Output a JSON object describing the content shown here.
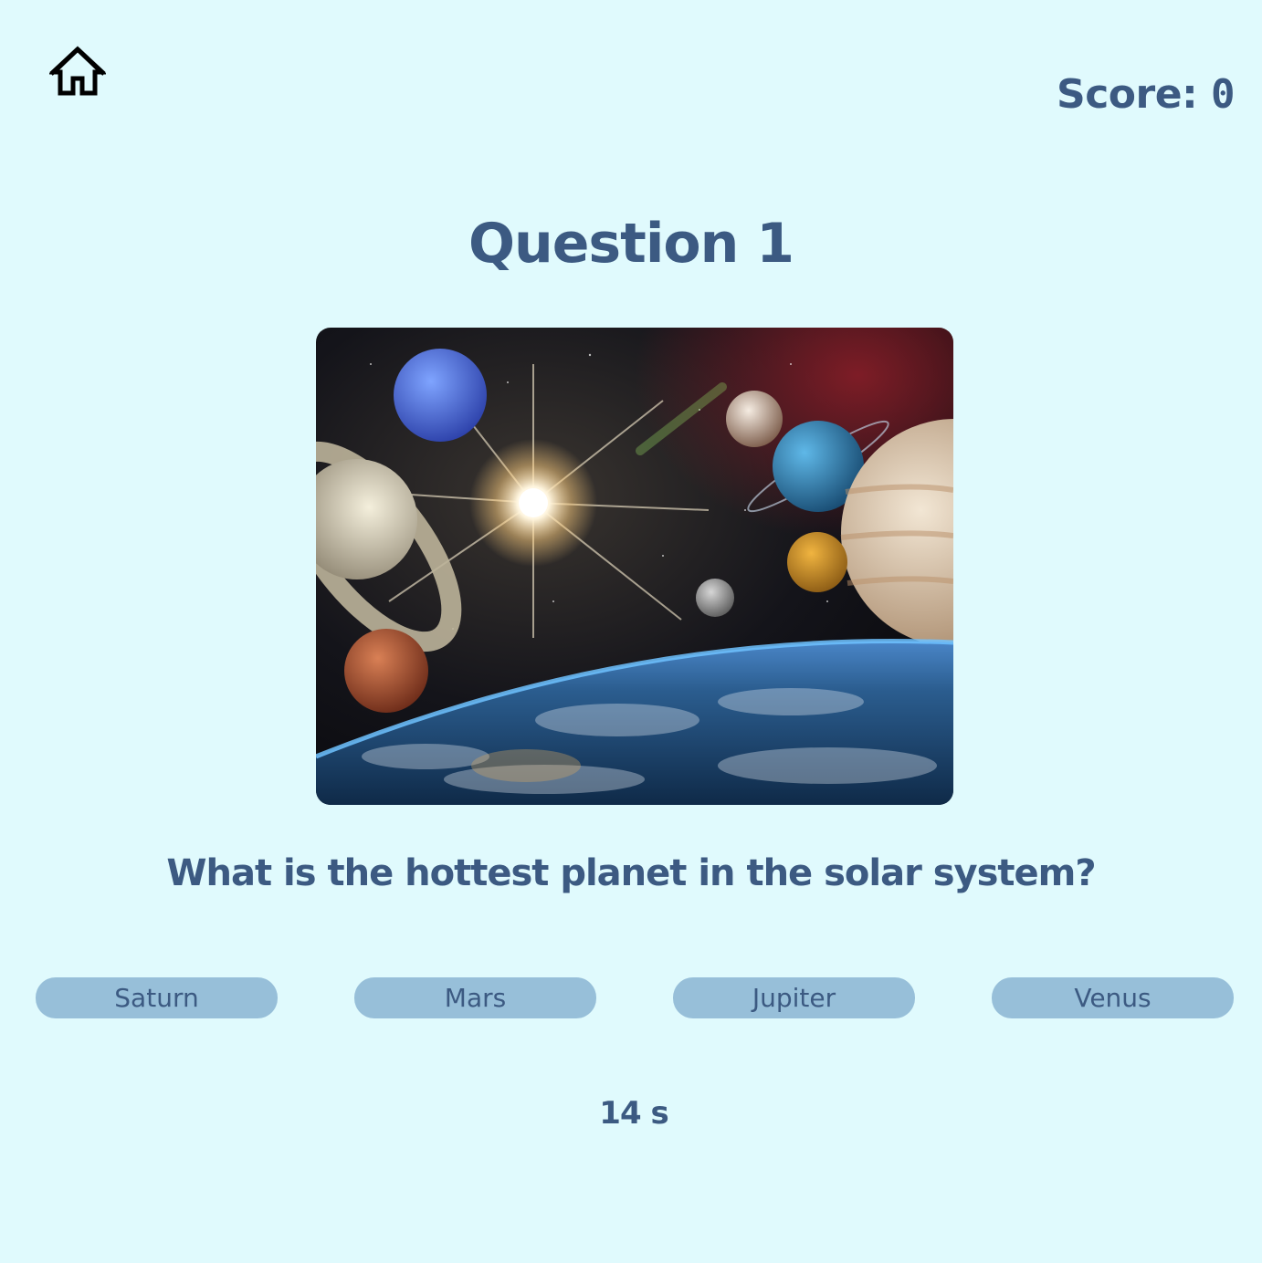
{
  "header": {
    "home_icon": "home-icon",
    "score_label": "Score:",
    "score_value": "0"
  },
  "question": {
    "title": "Question 1",
    "image_icon": "solar-system-illustration",
    "text": "What is the hottest planet in the solar system?",
    "answers": [
      {
        "label": "Saturn"
      },
      {
        "label": "Mars"
      },
      {
        "label": "Jupiter"
      },
      {
        "label": "Venus"
      }
    ]
  },
  "timer": {
    "text": "14 s"
  },
  "colors": {
    "background": "#e0fafd",
    "text": "#3c5a82",
    "answer_button": "#97bfd9"
  }
}
